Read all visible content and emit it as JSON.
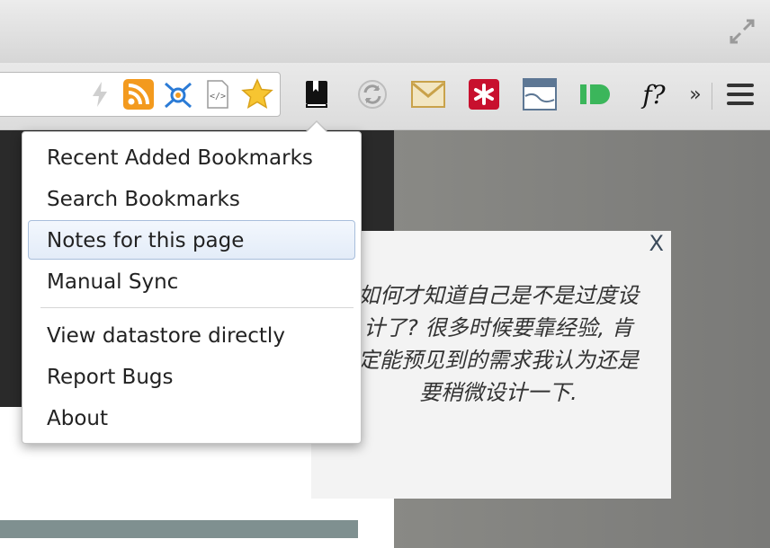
{
  "window": {
    "fullscreen_icon": "fullscreen-arrows-icon"
  },
  "toolbar": {
    "extensions": [
      {
        "name": "lightning-icon"
      },
      {
        "name": "rss-feed-icon",
        "color": "#f39a1e"
      },
      {
        "name": "network-molecule-icon",
        "color": "#2b7bd6"
      },
      {
        "name": "source-code-icon"
      },
      {
        "name": "bookmark-star-icon",
        "color": "#f7c531"
      },
      {
        "name": "bookmark-book-icon"
      },
      {
        "name": "sync-icon"
      },
      {
        "name": "gmail-icon"
      },
      {
        "name": "lastpass-icon",
        "color": "#c8102e"
      },
      {
        "name": "window-icon"
      },
      {
        "name": "pushbullet-icon",
        "color": "#3bb65b"
      },
      {
        "name": "font-question-icon",
        "label": "f?"
      },
      {
        "name": "overflow-chevron",
        "label": "»"
      },
      {
        "name": "menu-hamburger-icon"
      }
    ]
  },
  "dropdown": {
    "items": [
      {
        "label": "Recent Added Bookmarks"
      },
      {
        "label": "Search Bookmarks"
      },
      {
        "label": "Notes for this page"
      },
      {
        "label": "Manual Sync"
      },
      {
        "label": "View datastore directly"
      },
      {
        "label": "Report Bugs"
      },
      {
        "label": "About"
      }
    ],
    "highlighted_index": 2
  },
  "note_panel": {
    "close_label": "X",
    "text": "如何才知道自己是不是过度设计了? 很多时候要靠经验, 肯定能预见到的需求我认为还是要稍微设计一下."
  }
}
